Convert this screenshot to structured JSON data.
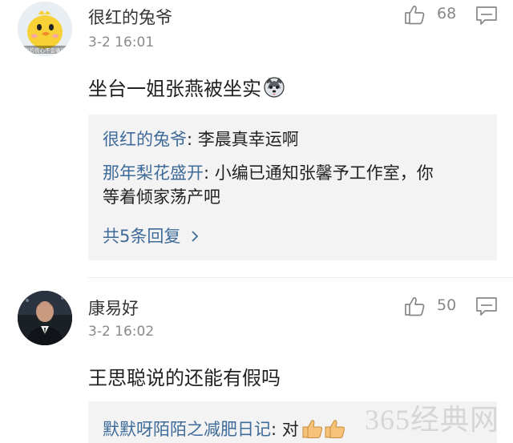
{
  "comments": [
    {
      "author": "很红的兔爷",
      "avatar_icon": "yellow-chicken-avatar",
      "avatar_caption": "我的良心不会痛的",
      "time": "3-2 16:01",
      "likes": "68",
      "text": "坐台一姐张燕被坐实",
      "text_emoji": "husky-dog-emoji",
      "replies": [
        {
          "author": "很红的兔爷",
          "sep": ": ",
          "text": "李晨真幸运啊"
        },
        {
          "author": "那年梨花盛开",
          "sep": ": ",
          "text_line1": "小编已通知张馨予工作室，你",
          "text_line2": "等着倾家荡产吧"
        }
      ],
      "more_replies": "共5条回复",
      "more_icon": "chevron-right-icon"
    },
    {
      "author": "康易好",
      "avatar_icon": "man-in-suit-avatar",
      "time": "3-2 16:02",
      "likes": "50",
      "text": "王思聪说的还能有假吗",
      "replies": [
        {
          "author": "默默呀陌陌之减肥日记",
          "sep": ": ",
          "text": "对",
          "emoji": "thumbs-up-emoji"
        }
      ]
    }
  ],
  "watermark": "365经典网",
  "colors": {
    "link": "#3e6b9a",
    "meta": "#8a8a8a",
    "reply_bg": "#f3f3f3"
  }
}
